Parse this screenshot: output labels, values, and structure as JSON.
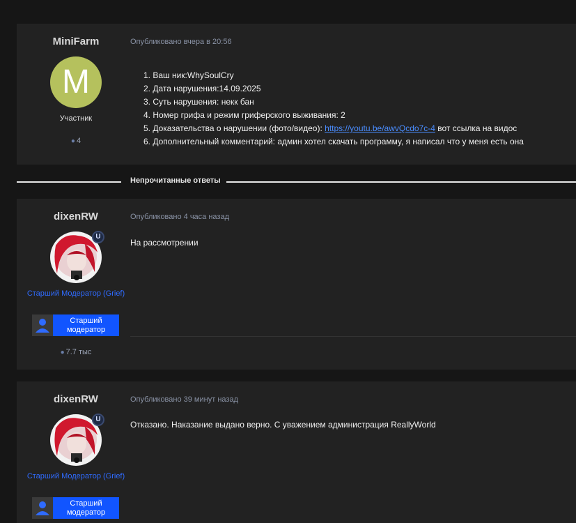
{
  "posts": [
    {
      "author": "MiniFarm",
      "avatar_letter": "M",
      "avatar_color": "#b5c15d",
      "title": "Участник",
      "post_count": "4",
      "meta": "Опубликовано вчера в 20:56",
      "report": {
        "items": [
          "1. Ваш ник:WhySoulCry",
          "2. Дата нарушения:14.09.2025",
          "3. Суть нарушения: некк бан",
          "4. Номер грифа и режим гриферского выживания: 2"
        ],
        "item5_prefix": "5. Доказательства о нарушении (фото/видео): ",
        "item5_link": "https://youtu.be/awvQcdo7c-4",
        "item5_suffix": " вот ссылка на видос",
        "item6": "6. Дополнительный комментарий: админ хотел скачать программу, я написал что у меня есть она"
      }
    },
    {
      "author": "dixenRW",
      "badge_letter": "U",
      "title": "Старший Модератор (Grief)",
      "group_label": "Старший модератор",
      "group_color": "#1155ff",
      "post_count": "7.7 тыс",
      "meta": "Опубликовано 4 часа назад",
      "body": "На рассмотрении"
    },
    {
      "author": "dixenRW",
      "badge_letter": "U",
      "title": "Старший Модератор (Grief)",
      "group_label": "Старший модератор",
      "group_color": "#1155ff",
      "meta": "Опубликовано 39 минут назад",
      "body": "Отказано. Наказание выдано верно. С уважением администрация ReallyWorld"
    }
  ],
  "separator": {
    "label": "Непрочитанные ответы"
  },
  "icons": {
    "comment": "comment-icon",
    "user": "user-icon",
    "mod_badge": "moderator-badge-icon"
  }
}
